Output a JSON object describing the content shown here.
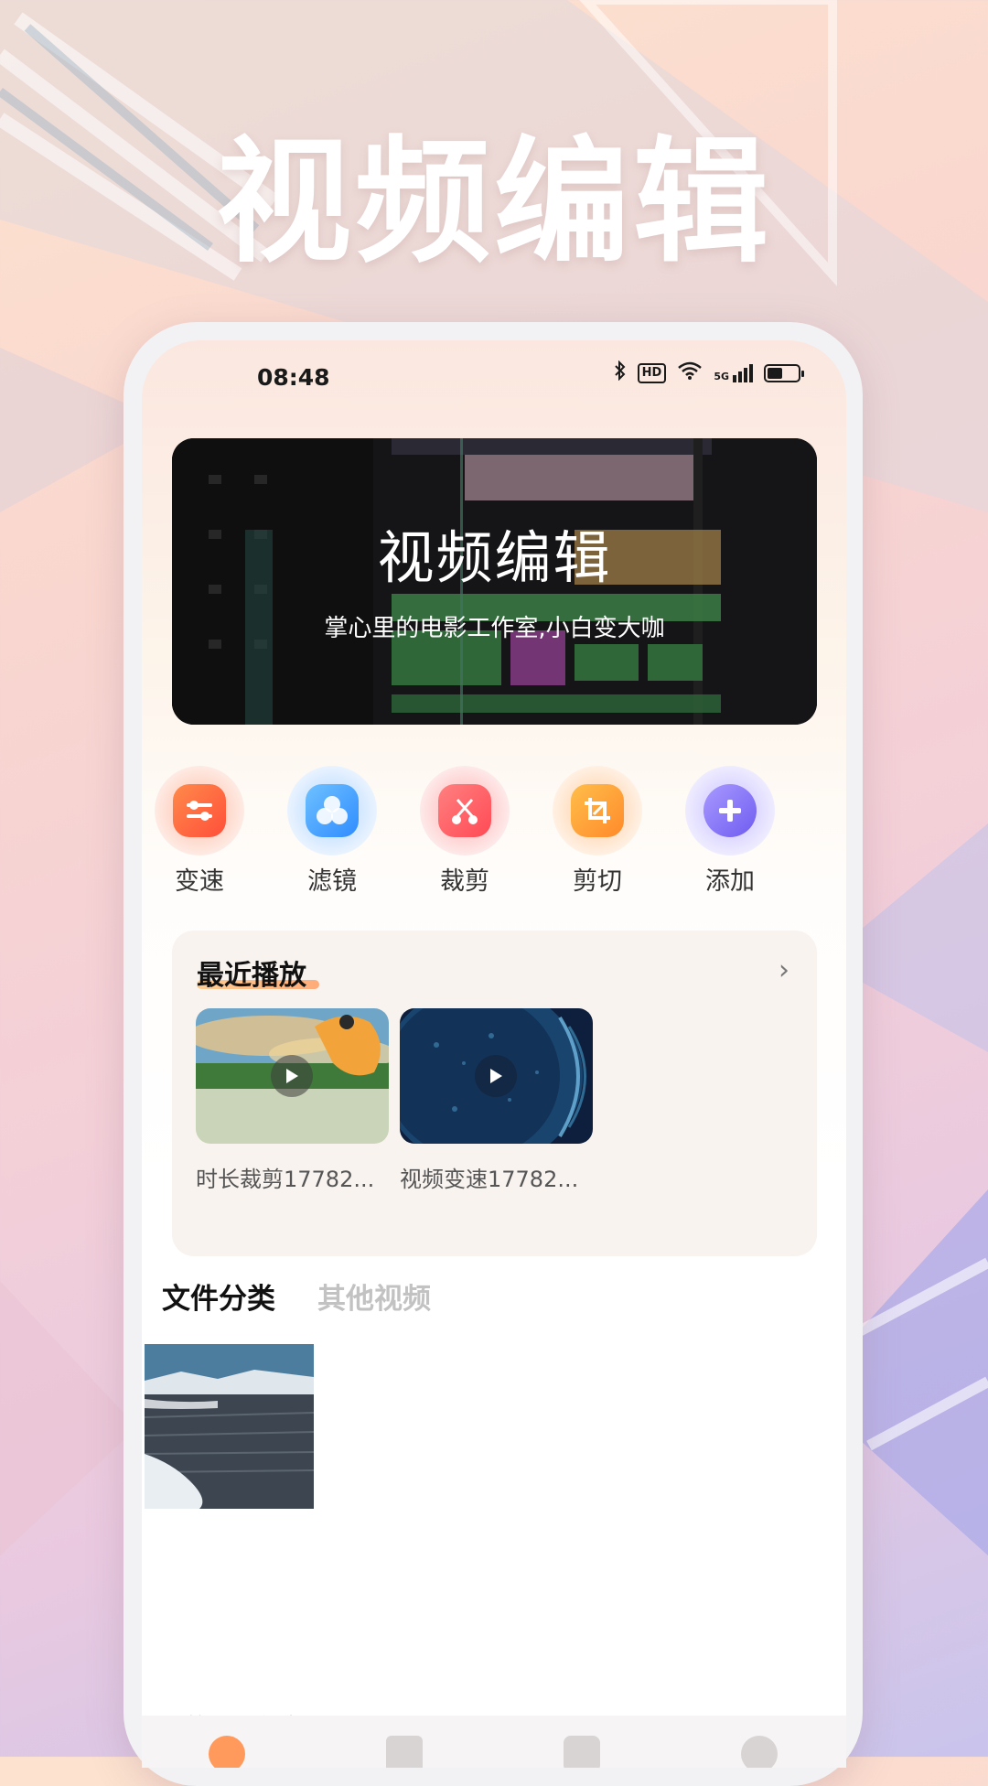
{
  "hero": {
    "title": "视频编辑"
  },
  "status_bar": {
    "time": "08:48",
    "hd": "HD",
    "network": "5G"
  },
  "banner": {
    "title": "视频编辑",
    "subtitle": "掌心里的电影工作室,小白变大咖"
  },
  "tools": [
    {
      "label": "变速",
      "icon": "sliders-icon",
      "color": "#ff6a3d"
    },
    {
      "label": "滤镜",
      "icon": "circles-icon",
      "color": "#3da8ff"
    },
    {
      "label": "裁剪",
      "icon": "scissors-icon",
      "color": "#ff5a5a"
    },
    {
      "label": "剪切",
      "icon": "crop-icon",
      "color": "#ffa233"
    },
    {
      "label": "添加",
      "icon": "plus-icon",
      "color": "#8a7bff"
    }
  ],
  "recent": {
    "title": "最近播放",
    "items": [
      {
        "label": "时长裁剪17782..."
      },
      {
        "label": "视频变速17782..."
      }
    ]
  },
  "tabs": [
    {
      "label": "文件分类",
      "active": true
    },
    {
      "label": "其他视频",
      "active": false
    }
  ],
  "bottom": {
    "section_label": "我的休闲视频"
  },
  "colors": {
    "accent": "#ff9a5c",
    "bg": "#fdeee6"
  }
}
